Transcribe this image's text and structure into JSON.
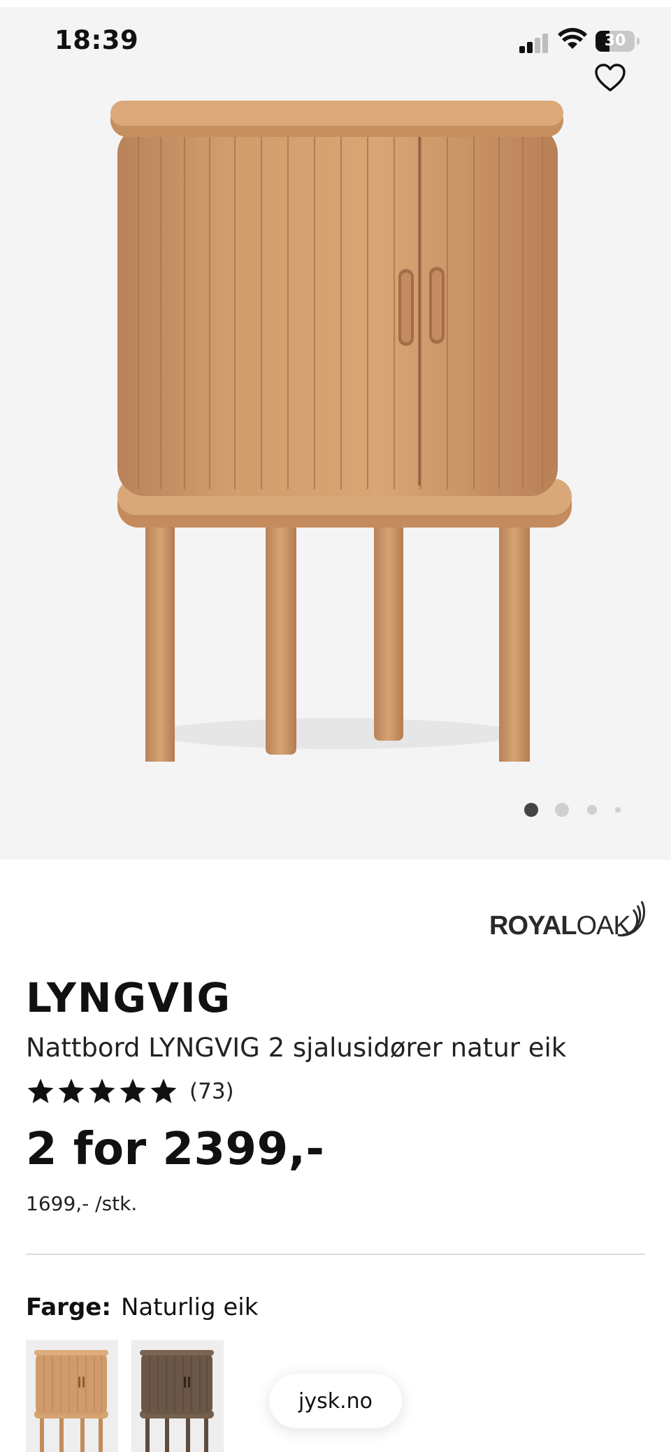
{
  "status_bar": {
    "time": "18:39",
    "battery": "30"
  },
  "product": {
    "brand": {
      "name_bold": "ROYAL",
      "name_light": "OAK"
    },
    "title": "LYNGVIG",
    "description": "Nattbord LYNGVIG 2 sjalusidører natur eik",
    "rating": {
      "stars": 5,
      "count": "(73)"
    },
    "price": "2 for 2399,-",
    "unit_price": "1699,- /stk.",
    "color": {
      "label": "Farge:",
      "value": "Naturlig eik"
    },
    "gallery": {
      "total_images": 4,
      "active_index": 0
    },
    "variants": [
      {
        "name": "natural-oak",
        "color": "#c99464"
      },
      {
        "name": "dark-oak",
        "color": "#6b5748"
      }
    ]
  },
  "domain_pill": {
    "label": "jysk.no"
  },
  "icons": [
    "signal-icon",
    "wifi-icon",
    "battery-icon",
    "heart-icon",
    "star-icon"
  ]
}
